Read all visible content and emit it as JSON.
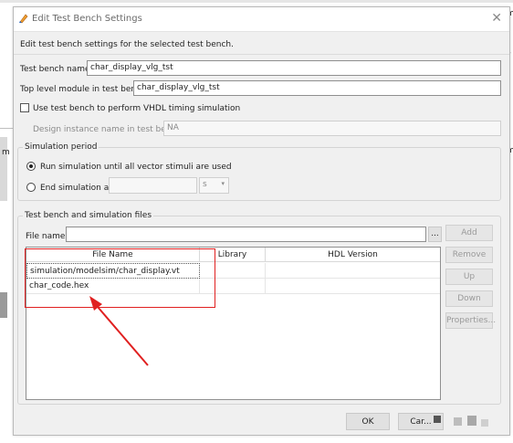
{
  "dialog": {
    "title": "Edit Test Bench Settings",
    "description": "Edit test bench settings for the selected test bench."
  },
  "testbench": {
    "name_label": "Test bench name:",
    "name_value": "char_display_vlg_tst",
    "toplevel_label": "Top level module in test bench:",
    "toplevel_value": "char_display_vlg_tst",
    "vhdl_timing_label": "Use test bench to perform VHDL timing simulation",
    "design_instance_label": "Design instance name in test bench:",
    "design_instance_value": "NA"
  },
  "simulation_period": {
    "title": "Simulation period",
    "run_until_label": "Run simulation until all vector stimuli are used",
    "end_at_label": "End simulation at:",
    "unit_value": "s"
  },
  "files": {
    "title": "Test bench and simulation files",
    "file_name_label": "File name:",
    "browse_label": "...",
    "columns": [
      "File Name",
      "Library",
      "HDL Version"
    ],
    "rows": [
      {
        "file": "simulation/modelsim/char_display.vt",
        "library": "",
        "hdl": ""
      },
      {
        "file": "char_code.hex",
        "library": "",
        "hdl": ""
      }
    ],
    "buttons": {
      "add": "Add",
      "remove": "Remove",
      "up": "Up",
      "down": "Down",
      "properties": "Properties..."
    }
  },
  "footer": {
    "ok": "OK",
    "cancel": "Car..."
  },
  "background": {
    "right_letters": [
      "m",
      "r",
      "m"
    ],
    "left_letter": "m"
  },
  "colors": {
    "annotation_red": "#e02020"
  }
}
